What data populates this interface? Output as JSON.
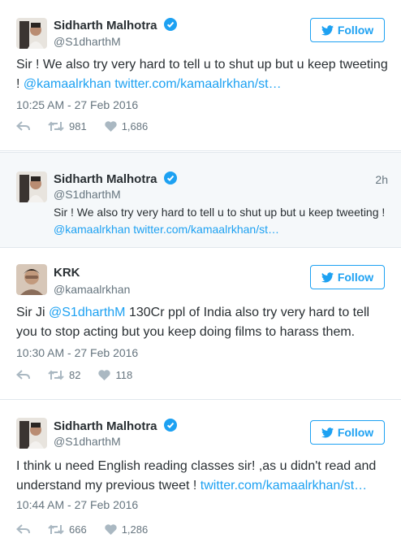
{
  "follow_label": "Follow",
  "accent_color": "#1da1f2",
  "tweets": [
    {
      "name": "Sidharth Malhotra",
      "handle": "@S1dharthM",
      "text_before": "Sir ! We also try very hard to tell u to shut up but u keep tweeting ! ",
      "mention": "@kamaalrkhan",
      "link": "twitter.com/kamaalrkhan/st…",
      "time": "10:25 AM - 27 Feb 2016",
      "retweets": "981",
      "likes": "1,686"
    },
    {
      "name": "Sidharth Malhotra",
      "handle": "@S1dharthM",
      "age": "2h",
      "text_before": "Sir ! We also try very hard to tell u to shut up but u keep tweeting !",
      "mention": "@kamaalrkhan",
      "link": "twitter.com/kamaalrkhan/st…"
    },
    {
      "name": "KRK",
      "handle": "@kamaalrkhan",
      "text_before": "Sir Ji ",
      "mention": "@S1dharthM",
      "text_after": " 130Cr ppl of India also try very hard to tell you to stop acting but you keep doing films to harass them.",
      "time": "10:30 AM - 27 Feb 2016",
      "retweets": "82",
      "likes": "118"
    },
    {
      "name": "Sidharth Malhotra",
      "handle": "@S1dharthM",
      "text_before": "I think u need English reading classes sir! ,as u didn't read and understand my previous tweet ! ",
      "link": "twitter.com/kamaalrkhan/st…",
      "time": "10:44 AM - 27 Feb 2016",
      "retweets": "666",
      "likes": "1,286"
    }
  ]
}
